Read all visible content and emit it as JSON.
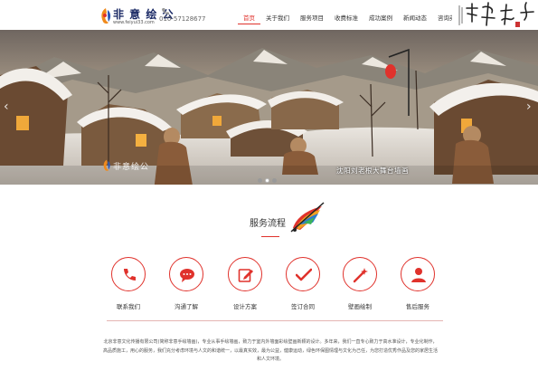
{
  "header": {
    "logo_text": "非 意 绘 公",
    "logo_url": "www.feiyui33.com",
    "phone": "010-57128677",
    "nav": [
      "首页",
      "关于我们",
      "服务项目",
      "收费标准",
      "成功案例",
      "新闻动态",
      "咨询英才"
    ],
    "nav_active": 0
  },
  "banner": {
    "caption": "沈阳刘老根大舞台墙画",
    "watermark": "非意绘公",
    "arrow_left": "‹",
    "arrow_right": "›",
    "slide_count": 3,
    "active_slide": 0
  },
  "service": {
    "title": "服务流程",
    "items": [
      {
        "label": "联系我们",
        "icon": "phone-icon"
      },
      {
        "label": "沟通了解",
        "icon": "chat-icon"
      },
      {
        "label": "设计方案",
        "icon": "edit-icon"
      },
      {
        "label": "签订合同",
        "icon": "check-icon"
      },
      {
        "label": "壁画绘制",
        "icon": "wand-icon"
      },
      {
        "label": "售后服务",
        "icon": "user-icon"
      }
    ],
    "accent_color": "#e0322c"
  },
  "about": {
    "text": "北京非意文化传播有限公司(简称非意手绘墙画)，专业从事手绘墙画，致力于室内外墙面彩绘壁画新颖的设计。多年来，我们一直专心致力于高水准设计，专业化制作，高品质施工，用心的服务，我们充分考虑环境与人文的和谐统一，以最真实效，最为公益，健康运动，绿色环保图情理与文化为己任，为您打造优秀作品及您的家居生活和人文环境。"
  }
}
